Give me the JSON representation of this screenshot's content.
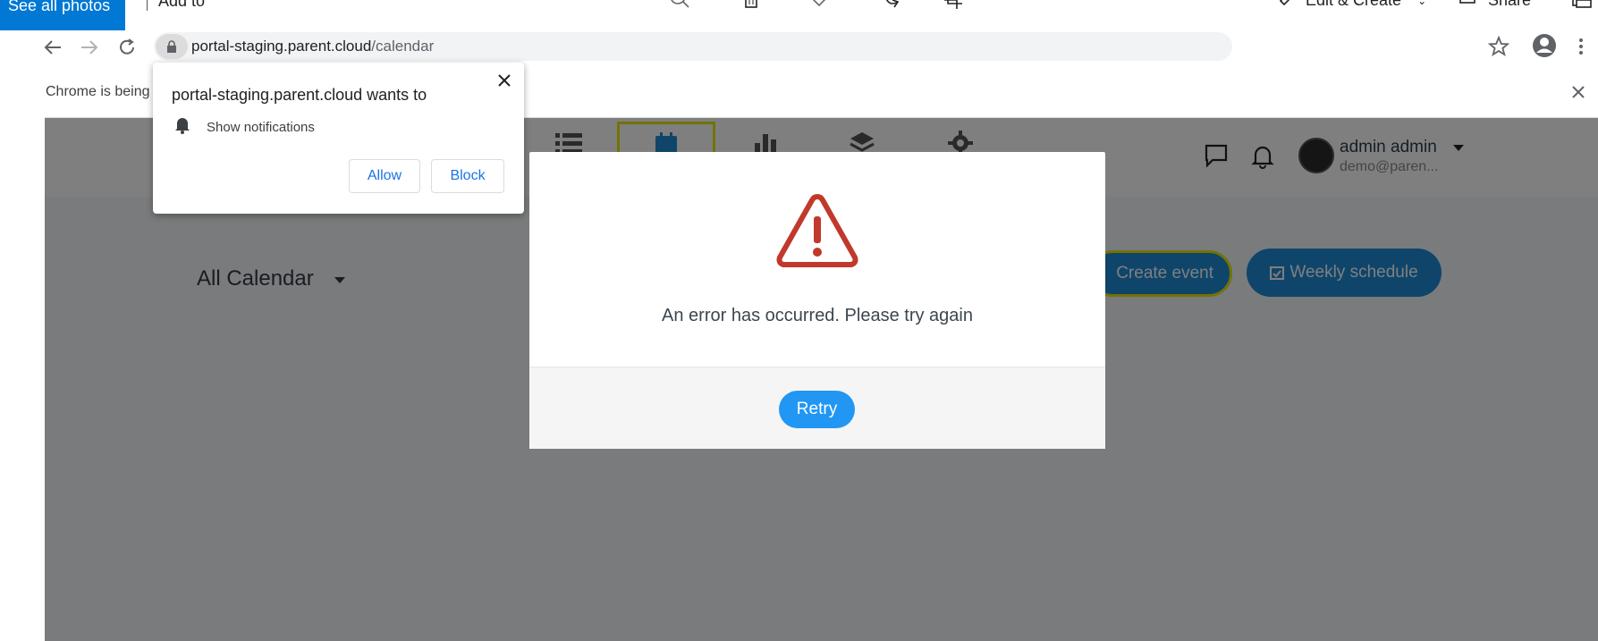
{
  "photos_bar": {
    "see_all": "See all photos",
    "add_to": "Add to",
    "edit_create": "Edit & Create",
    "share": "Share"
  },
  "browser": {
    "url_host": "portal-staging.parent.cloud",
    "url_path": "/calendar",
    "infobar_text": "Chrome is being"
  },
  "permission_popup": {
    "title": "portal-staging.parent.cloud wants to",
    "permission": "Show notifications",
    "allow_label": "Allow",
    "block_label": "Block"
  },
  "app_header": {
    "user_name": "admin admin",
    "user_email": "demo@paren..."
  },
  "page": {
    "title": "All Calendar",
    "create_event_label": "Create event",
    "weekly_schedule_label": "Weekly schedule"
  },
  "error_modal": {
    "message": "An error has occurred. Please try again",
    "retry_label": "Retry"
  },
  "colors": {
    "primary_blue": "#2196f3",
    "error_red": "#c0392b",
    "highlight_yellow": "#e6e600",
    "photos_blue": "#0078d4"
  }
}
